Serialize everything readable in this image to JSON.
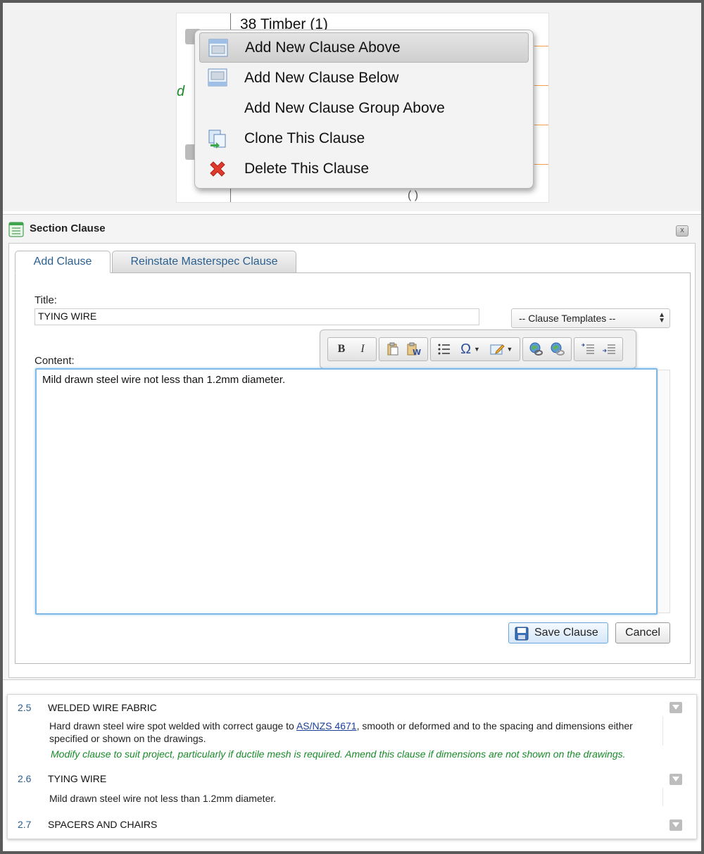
{
  "doc_snippet": {
    "heading": "38 Timber (1)",
    "green_fragment": "d",
    "tail_fragment": "(  )"
  },
  "context_menu": {
    "items": [
      {
        "label": "Add New Clause Above",
        "icon": "clause-above-icon"
      },
      {
        "label": "Add New Clause Below",
        "icon": "clause-below-icon"
      },
      {
        "label": "Add New Clause Group Above",
        "icon": ""
      },
      {
        "label": "Clone This Clause",
        "icon": "clone-icon"
      },
      {
        "label": "Delete This Clause",
        "icon": "delete-x-icon"
      }
    ]
  },
  "dialog": {
    "title": "Section Clause",
    "close_label": "x",
    "tabs": [
      {
        "label": "Add Clause",
        "active": true
      },
      {
        "label": "Reinstate Masterspec Clause",
        "active": false
      }
    ],
    "title_label": "Title:",
    "title_value": "TYING WIRE",
    "templates_select": "-- Clause Templates --",
    "content_label": "Content:",
    "content_value": "Mild drawn steel wire not less than 1.2mm diameter.",
    "toolbar": {
      "bold": "B",
      "italic": "I",
      "special_char": "Ω"
    },
    "save_label": "Save Clause",
    "cancel_label": "Cancel"
  },
  "clauses": [
    {
      "number": "2.5",
      "title": "WELDED WIRE FABRIC",
      "body_before_link": "Hard drawn steel wire spot welded with correct gauge to ",
      "link": "AS/NZS 4671",
      "body_after_link": ", smooth or deformed and to the spacing and dimensions either specified or shown on the drawings.",
      "note": "Modify clause to suit project, particularly if ductile mesh is required. Amend this clause if dimensions are not shown on the drawings."
    },
    {
      "number": "2.6",
      "title": "TYING WIRE",
      "body": "Mild drawn steel wire not less than 1.2mm diameter."
    },
    {
      "number": "2.7",
      "title": "SPACERS AND CHAIRS"
    }
  ],
  "colors": {
    "link_blue": "#2a5f8f",
    "note_green": "#1a8a2a",
    "focus_blue": "#7fb9e8",
    "delete_red": "#e03a2a"
  }
}
